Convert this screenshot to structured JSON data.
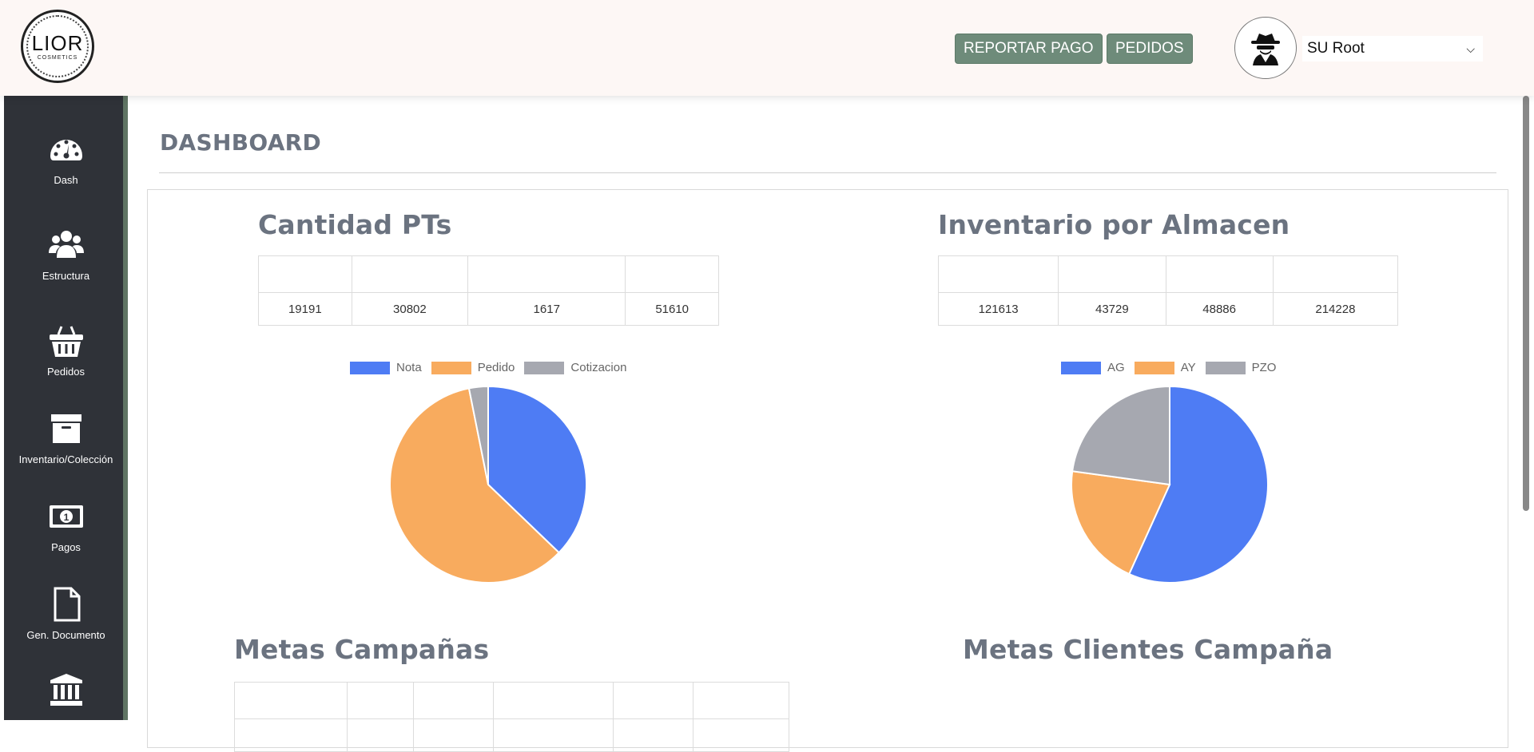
{
  "logo": {
    "text": "LIOR",
    "subtext": "COSMETICS"
  },
  "header": {
    "report_payment_label": "REPORTAR PAGO",
    "orders_label": "PEDIDOS",
    "user_name": "SU Root"
  },
  "sidebar": {
    "items": [
      {
        "label": "Dash",
        "icon": "gauge-icon"
      },
      {
        "label": "Estructura",
        "icon": "users-icon"
      },
      {
        "label": "Pedidos",
        "icon": "basket-icon"
      },
      {
        "label": "Inventario/Colección",
        "icon": "archive-box-icon"
      },
      {
        "label": "Pagos",
        "icon": "money-bill-icon"
      },
      {
        "label": "Gen. Documento",
        "icon": "document-icon"
      },
      {
        "label": "",
        "icon": "bank-icon"
      }
    ]
  },
  "page": {
    "title": "DASHBOARD"
  },
  "cantidad": {
    "title": "Cantidad PTs",
    "headers": [
      "",
      "",
      "",
      ""
    ],
    "values": [
      "19191",
      "30802",
      "1617",
      "51610"
    ]
  },
  "inventario": {
    "title": "Inventario por Almacen",
    "headers": [
      "",
      "",
      "",
      ""
    ],
    "values": [
      "121613",
      "43729",
      "48886",
      "214228"
    ]
  },
  "metas_campanas": {
    "title": "Metas Campañas"
  },
  "metas_clientes": {
    "title": "Metas Clientes Campaña"
  },
  "colors": {
    "blue": "#4e7cf4",
    "orange": "#f8ab5e",
    "gray": "#a6a8b0",
    "accent": "#6e8b7a"
  },
  "chart_data": [
    {
      "type": "pie",
      "title": "",
      "legend_position": "top",
      "categories": [
        "Nota",
        "Pedido",
        "Cotizacion"
      ],
      "values": [
        19191,
        30802,
        1617
      ],
      "colors": [
        "#4e7cf4",
        "#f8ab5e",
        "#a6a8b0"
      ]
    },
    {
      "type": "pie",
      "title": "",
      "legend_position": "top",
      "categories": [
        "AG",
        "AY",
        "PZO"
      ],
      "values": [
        121613,
        43729,
        48886
      ],
      "colors": [
        "#4e7cf4",
        "#f8ab5e",
        "#a6a8b0"
      ]
    }
  ]
}
